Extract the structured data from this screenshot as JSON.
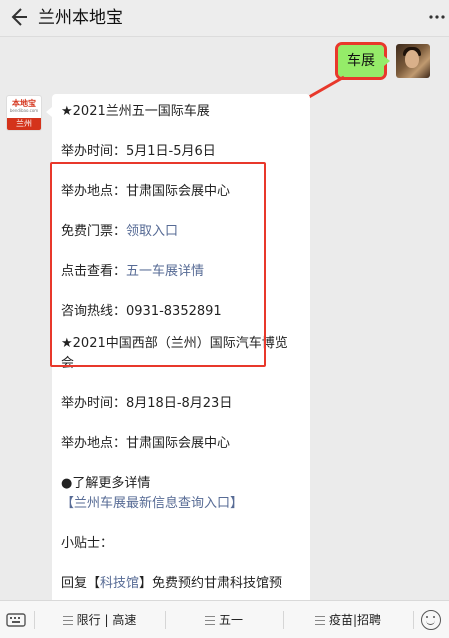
{
  "header": {
    "back_icon": "arrow-left-icon",
    "title": "兰州本地宝",
    "more_icon": "more-dots-icon"
  },
  "messages": {
    "outgoing": {
      "text": "车展"
    },
    "incoming": {
      "avatar": {
        "logo_text": "本地宝",
        "logo_sub": "bendibao.com",
        "logo_city": "兰州"
      },
      "lines": [
        "★2021兰州五一国际车展",
        "",
        "举办时间：5月1日-5月6日",
        "",
        "举办地点：甘肃国际会展中心",
        "",
        "免费门票：",
        "领取入口",
        "",
        "点击查看：",
        "五一车展详情",
        "",
        "咨询热线：0931-8352891",
        "★2021中国西部（兰州）国际汽车博览",
        "会",
        "",
        "举办时间：8月18日-8月23日",
        "",
        "举办地点：甘肃国际会展中心",
        "",
        "●了解更多详情",
        "【兰州车展最新信息查询入口】",
        "",
        "小贴士：",
        "",
        "回复【",
        "科技馆",
        "】免费预约甘肃科技馆预"
      ]
    }
  },
  "bottom_menu": {
    "keyboard_icon": "keyboard-icon",
    "items": [
      "限行 | 高速",
      "五一",
      "疫苗|招聘"
    ],
    "emoji_icon": "emoji-icon"
  },
  "colors": {
    "bubble_out": "#95ec69",
    "link": "#576b95",
    "highlight": "#e8382b"
  }
}
